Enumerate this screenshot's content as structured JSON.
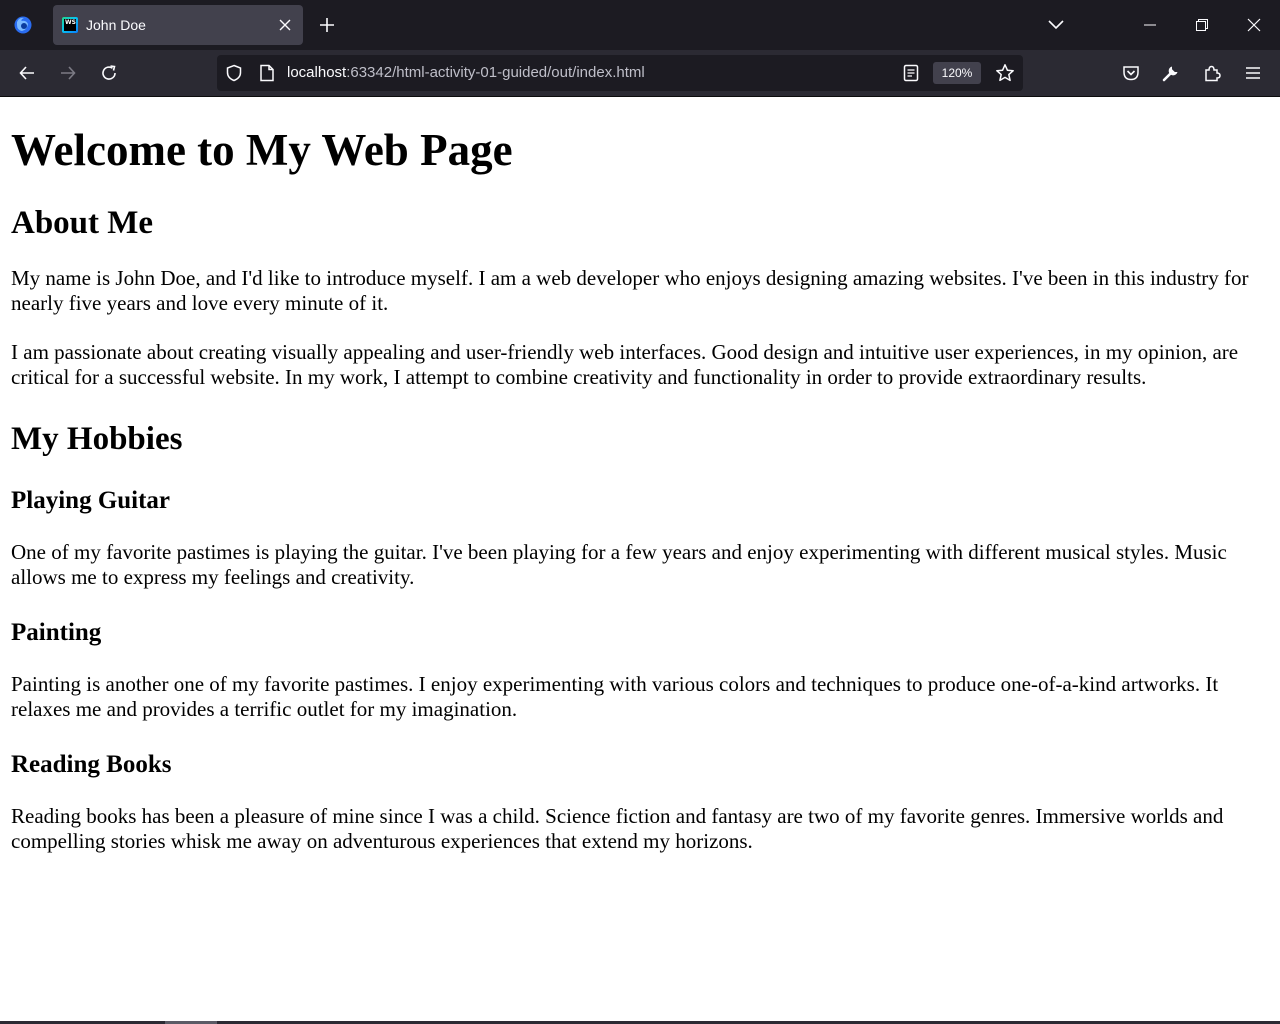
{
  "browser": {
    "tab_title": "John Doe",
    "favicon_text": "WS",
    "url_host": "localhost",
    "url_rest": ":63342/html-activity-01-guided/out/index.html",
    "zoom": "120%"
  },
  "page": {
    "h1": "Welcome to My Web Page",
    "about_heading": "About Me",
    "about_p1": "My name is John Doe, and I'd like to introduce myself. I am a web developer who enjoys designing amazing websites. I've been in this industry for nearly five years and love every minute of it.",
    "about_p2": "I am passionate about creating visually appealing and user-friendly web interfaces. Good design and intuitive user experiences, in my opinion, are critical for a successful website. In my work, I attempt to combine creativity and functionality in order to provide extraordinary results.",
    "hobbies_heading": "My Hobbies",
    "hobbies": [
      {
        "title": "Playing Guitar",
        "text": "One of my favorite pastimes is playing the guitar. I've been playing for a few years and enjoy experimenting with different musical styles. Music allows me to express my feelings and creativity."
      },
      {
        "title": "Painting",
        "text": "Painting is another one of my favorite pastimes. I enjoy experimenting with various colors and techniques to produce one-of-a-kind artworks. It relaxes me and provides a terrific outlet for my imagination."
      },
      {
        "title": "Reading Books",
        "text": "Reading books has been a pleasure of mine since I was a child. Science fiction and fantasy are two of my favorite genres. Immersive worlds and compelling stories whisk me away on adventurous experiences that extend my horizons."
      }
    ]
  }
}
